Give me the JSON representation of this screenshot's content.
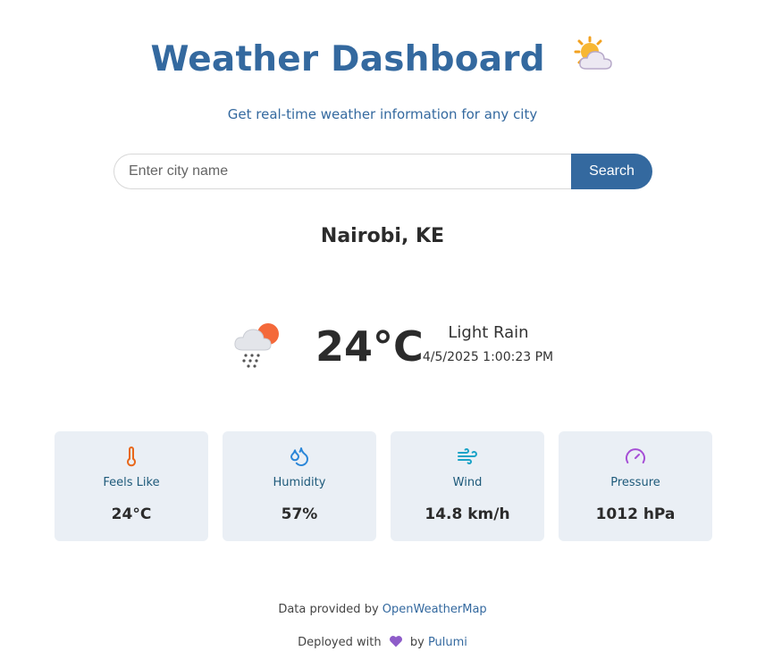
{
  "header": {
    "title": "Weather Dashboard",
    "title_icon": "sun-behind-cloud-icon"
  },
  "subtitle": "Get real-time weather information for any city",
  "search": {
    "placeholder": "Enter city name",
    "value": "",
    "button_label": "Search"
  },
  "current": {
    "city": "Nairobi, KE",
    "icon": "rain-cloud-sun-icon",
    "temperature": "24°C",
    "description": "Light Rain",
    "datetime": "4/5/2025 1:00:23 PM"
  },
  "cards": [
    {
      "icon": "thermometer-icon",
      "label": "Feels Like",
      "value": "24°C",
      "color": "#e8681c"
    },
    {
      "icon": "droplets-icon",
      "label": "Humidity",
      "value": "57%",
      "color": "#2a86d8"
    },
    {
      "icon": "wind-icon",
      "label": "Wind",
      "value": "14.8 km/h",
      "color": "#1ba3c7"
    },
    {
      "icon": "gauge-icon",
      "label": "Pressure",
      "value": "1012 hPa",
      "color": "#a64fd6"
    }
  ],
  "footer": {
    "data_text": "Data provided by",
    "data_link": "OpenWeatherMap",
    "deployed_text": "Deployed with",
    "heart_icon": "purple-heart-icon",
    "by_text": "by",
    "deployed_link": "Pulumi"
  },
  "colors": {
    "accent": "#34699f",
    "card_bg": "#eaeff5"
  }
}
